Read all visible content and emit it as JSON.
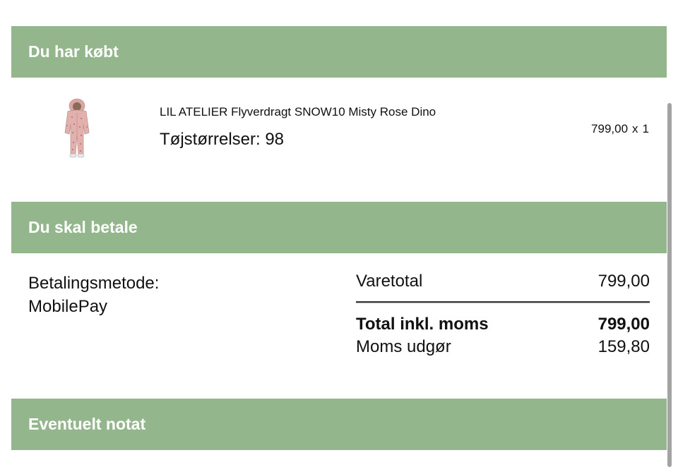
{
  "sections": {
    "bought": {
      "title": "Du har købt"
    },
    "pay": {
      "title": "Du skal betale"
    },
    "note": {
      "title": "Eventuelt notat"
    }
  },
  "product": {
    "name": "LIL ATELIER Flyverdragt SNOW10 Misty Rose Dino",
    "size": "Tøjstørrelser: 98",
    "price": "799,00",
    "times": "x",
    "quantity": "1",
    "image": "pink-snowsuit-thumbnail"
  },
  "payment": {
    "method_label": "Betalingsmetode:",
    "method_value": "MobilePay"
  },
  "totals": {
    "subtotal_label": "Varetotal",
    "subtotal_value": "799,00",
    "total_label": "Total inkl. moms",
    "total_value": "799,00",
    "vat_label": "Moms udgør",
    "vat_value": "159,80"
  },
  "colors": {
    "header_bg": "#94b68c",
    "header_text": "#ffffff"
  }
}
